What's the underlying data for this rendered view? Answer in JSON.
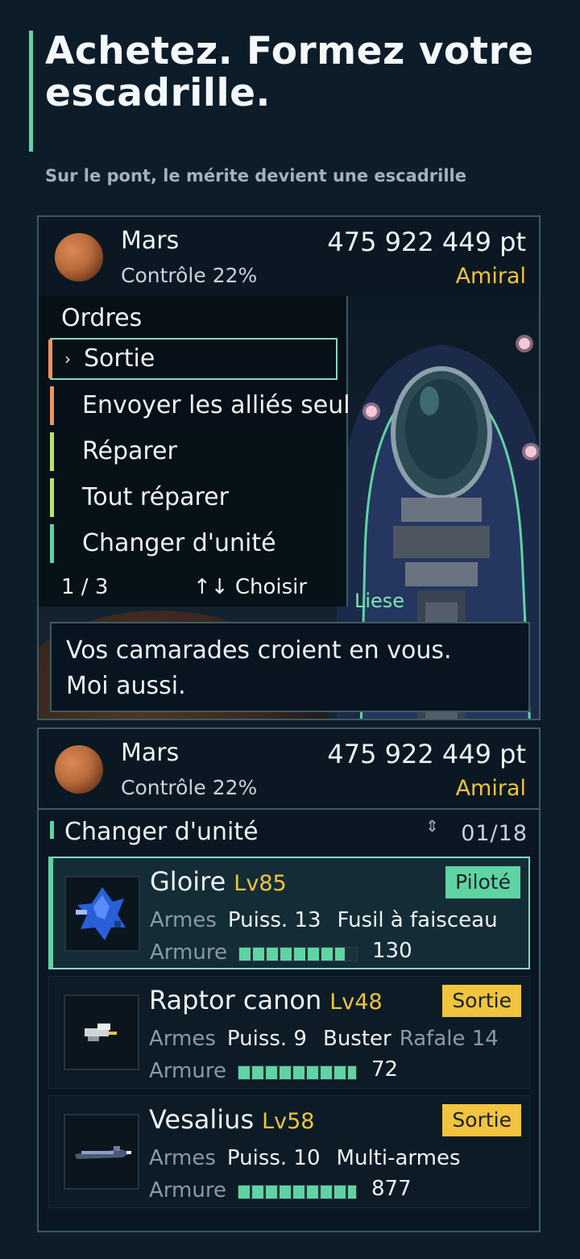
{
  "hero": {
    "title": "Achetez. Formez votre escadrille.",
    "subtitle": "Sur le pont, le mérite devient une escadrille"
  },
  "status": {
    "planet": "Mars",
    "control": "Contrôle 22%",
    "points": "475 922 449 pt",
    "rank": "Amiral"
  },
  "menu": {
    "title": "Ordres",
    "items": [
      {
        "label": "Sortie",
        "accent": "#f0925e"
      },
      {
        "label": "Envoyer les alliés seul",
        "accent": "#f0925e"
      },
      {
        "label": "Réparer",
        "accent": "#b7e46a"
      },
      {
        "label": "Tout réparer",
        "accent": "#b7e46a"
      },
      {
        "label": "Changer d'unité",
        "accent": "#5fd4a3"
      }
    ],
    "page": "1 / 3",
    "hint": "↑↓ Choisir"
  },
  "dialog": {
    "speaker": "Liese",
    "line1": "Vos camarades croient en vous.",
    "line2": "Moi aussi."
  },
  "units_panel": {
    "title": "Changer d'unité",
    "counter": "01/18",
    "counter_icon": "sort-icon",
    "labels": {
      "weapons": "Armes",
      "armor": "Armure"
    },
    "units": [
      {
        "name": "Gloire",
        "level": "Lv85",
        "tag": "Piloté",
        "power": "Puiss. 13",
        "weapon": "Fusil à faisceau",
        "extra": "",
        "armor": "130",
        "armor_level": 0.9,
        "thumb": "robot-icon"
      },
      {
        "name": "Raptor canon",
        "level": "Lv48",
        "tag": "Sortie",
        "power": "Puiss. 9",
        "weapon": "Buster",
        "extra": "Rafale 14",
        "armor": "72",
        "armor_level": 1.0,
        "thumb": "fighter-icon"
      },
      {
        "name": "Vesalius",
        "level": "Lv58",
        "tag": "Sortie",
        "power": "Puiss. 10",
        "weapon": "Multi-armes",
        "extra": "",
        "armor": "877",
        "armor_level": 1.0,
        "thumb": "battleship-icon"
      }
    ]
  }
}
